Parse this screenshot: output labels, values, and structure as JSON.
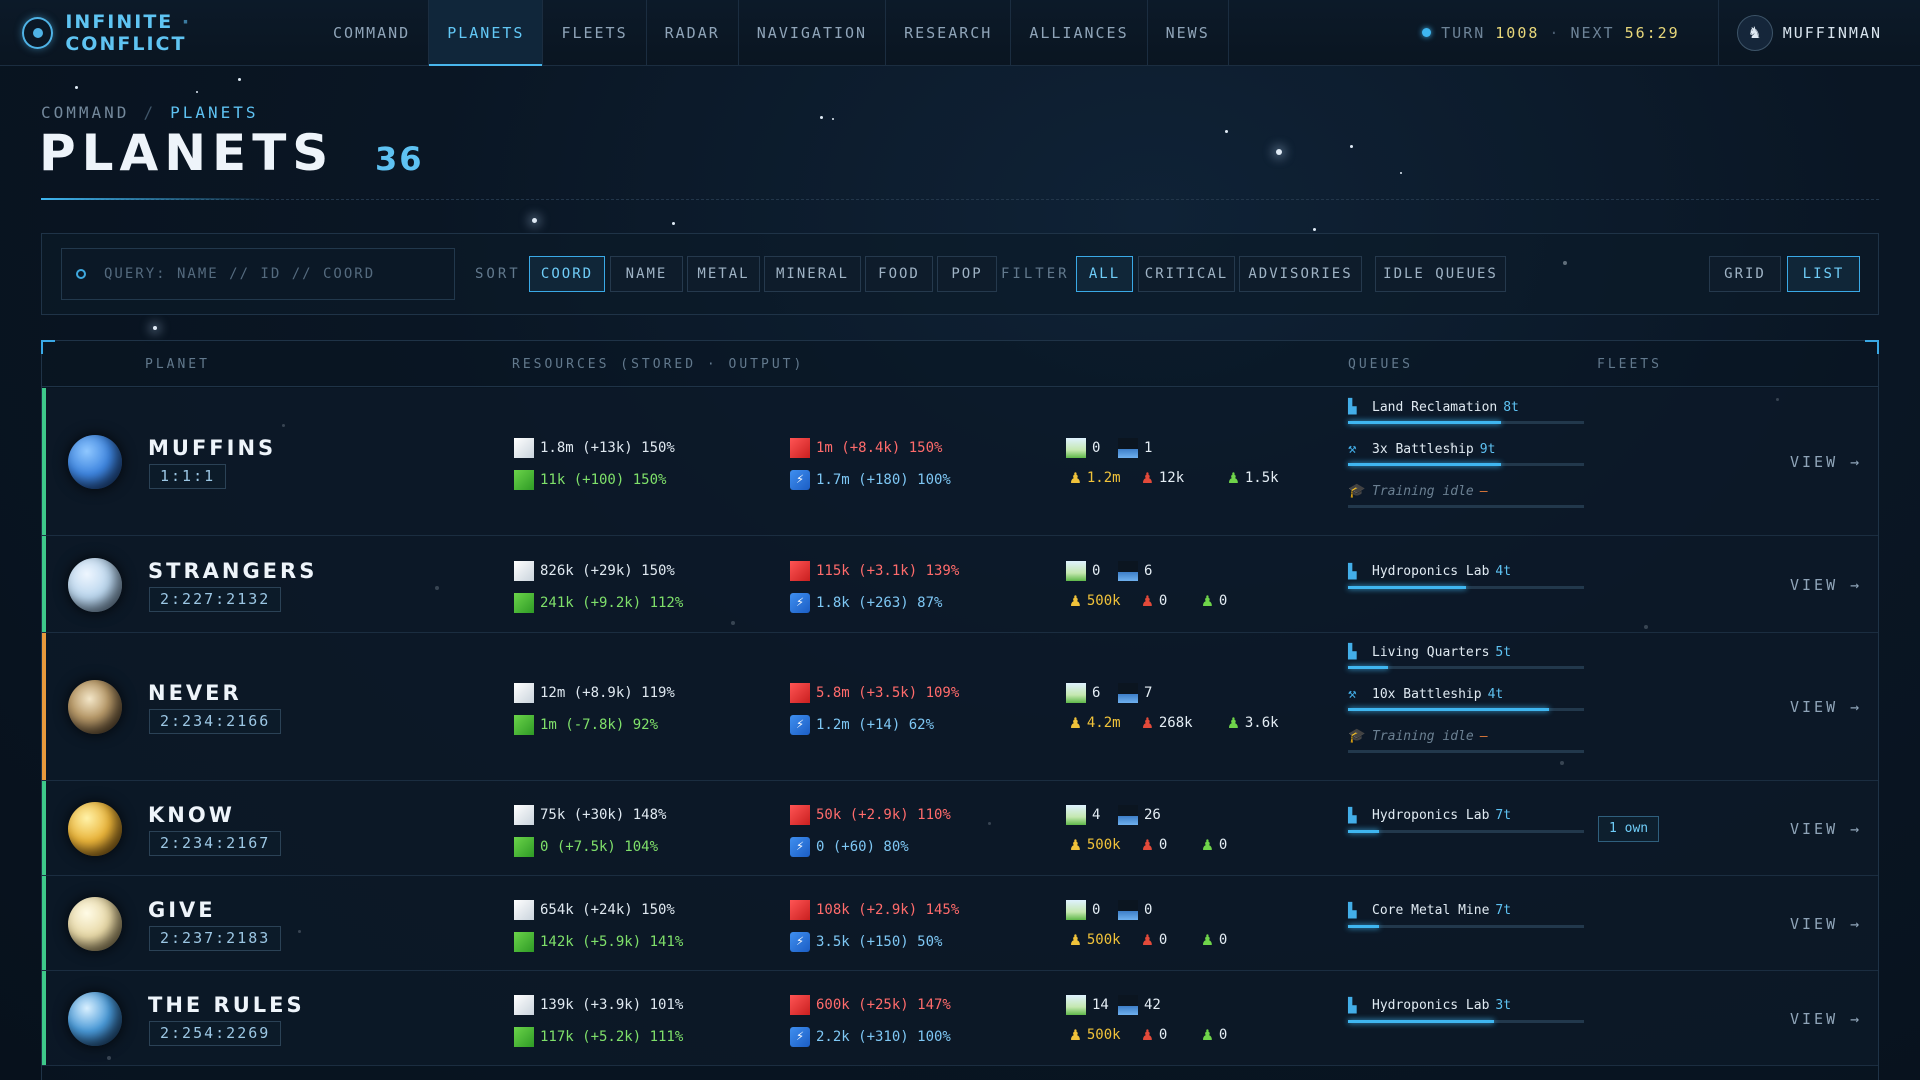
{
  "app": {
    "title_left": "INFINITE",
    "title_sep": "·",
    "title_right": "CONFLICT"
  },
  "nav": [
    "COMMAND",
    "PLANETS",
    "FLEETS",
    "RADAR",
    "NAVIGATION",
    "RESEARCH",
    "ALLIANCES",
    "NEWS"
  ],
  "nav_active": "PLANETS",
  "turn": {
    "label": "TURN",
    "value": "1008",
    "sep": "·",
    "next_label": "NEXT",
    "next_value": "56:29"
  },
  "user": {
    "name": "MUFFINMAN"
  },
  "breadcrumb": {
    "root": "COMMAND",
    "sep": "/",
    "current": "PLANETS"
  },
  "page": {
    "title": "PLANETS",
    "count": "36"
  },
  "search": {
    "placeholder": "QUERY: NAME // ID // COORD"
  },
  "sort": {
    "label": "SORT",
    "options": [
      "COORD",
      "NAME",
      "METAL",
      "MINERAL",
      "FOOD",
      "POP"
    ],
    "active": "COORD"
  },
  "filter": {
    "label": "FILTER",
    "options": [
      "ALL",
      "CRITICAL",
      "ADVISORIES",
      "IDLE QUEUES"
    ],
    "active": "ALL"
  },
  "view_toggle": {
    "options": [
      "GRID",
      "LIST"
    ],
    "active": "LIST"
  },
  "columns": {
    "planet": "PLANET",
    "resources": "RESOURCES (STORED · OUTPUT)",
    "queues": "QUEUES",
    "fleets": "FLEETS"
  },
  "view_label": "VIEW →",
  "colors": {
    "accent": "#3fb6f0",
    "green_status": "#3ec98a",
    "orange_status": "#e89a3c"
  },
  "planets": [
    {
      "name": "MUFFINS",
      "coord": "1:1:1",
      "status_color": "#3ec98a",
      "planet_color": "blue",
      "metal": "1.8m (+13k) 150%",
      "mineral": "1m (+8.4k) 150%",
      "food": "11k (+100) 150%",
      "energy": "1.7m (+180) 100%",
      "land": "0",
      "water": "1",
      "pop": "1.2m",
      "mil": "12k",
      "civ": "1.5k",
      "queues": [
        {
          "icon": "factory-icon",
          "text": "Land Reclamation",
          "turns": "8t",
          "progress": 0.65
        },
        {
          "icon": "hammer-icon",
          "text": "3x Battleship",
          "turns": "9t",
          "progress": 0.65
        },
        {
          "icon": "graduation-cap-icon",
          "text": "Training idle",
          "idle": true,
          "dash": "—"
        }
      ],
      "fleet": ""
    },
    {
      "name": "STRANGERS",
      "coord": "2:227:2132",
      "status_color": "#3ec98a",
      "planet_color": "pale",
      "metal": "826k (+29k) 150%",
      "mineral": "115k (+3.1k) 139%",
      "food": "241k (+9.2k) 112%",
      "energy": "1.8k (+263) 87%",
      "land": "0",
      "water": "6",
      "pop": "500k",
      "mil": "0",
      "civ": "0",
      "queues": [
        {
          "icon": "factory-icon",
          "text": "Hydroponics Lab",
          "turns": "4t",
          "progress": 0.5
        }
      ],
      "fleet": ""
    },
    {
      "name": "NEVER",
      "coord": "2:234:2166",
      "status_color": "#e89a3c",
      "planet_color": "rocky",
      "metal": "12m (+8.9k) 119%",
      "mineral": "5.8m (+3.5k) 109%",
      "food": "1m (-7.8k) 92%",
      "energy": "1.2m (+14) 62%",
      "land": "6",
      "water": "7",
      "pop": "4.2m",
      "mil": "268k",
      "civ": "3.6k",
      "queues": [
        {
          "icon": "factory-icon",
          "text": "Living Quarters",
          "turns": "5t",
          "progress": 0.17
        },
        {
          "icon": "hammer-icon",
          "text": "10x Battleship",
          "turns": "4t",
          "progress": 0.85
        },
        {
          "icon": "graduation-cap-icon",
          "text": "Training idle",
          "idle": true,
          "dash": "—"
        }
      ],
      "fleet": ""
    },
    {
      "name": "KNOW",
      "coord": "2:234:2167",
      "status_color": "#3ec98a",
      "planet_color": "gold",
      "metal": "75k (+30k) 148%",
      "mineral": "50k (+2.9k) 110%",
      "food": "0 (+7.5k) 104%",
      "energy": "0 (+60) 80%",
      "land": "4",
      "water": "26",
      "pop": "500k",
      "mil": "0",
      "civ": "0",
      "queues": [
        {
          "icon": "factory-icon",
          "text": "Hydroponics Lab",
          "turns": "7t",
          "progress": 0.13
        }
      ],
      "fleet": "1 own"
    },
    {
      "name": "GIVE",
      "coord": "2:237:2183",
      "status_color": "#3ec98a",
      "planet_color": "cream",
      "metal": "654k (+24k) 150%",
      "mineral": "108k (+2.9k) 145%",
      "food": "142k (+5.9k) 141%",
      "energy": "3.5k (+150) 50%",
      "land": "0",
      "water": "0",
      "pop": "500k",
      "mil": "0",
      "civ": "0",
      "queues": [
        {
          "icon": "factory-icon",
          "text": "Core Metal Mine",
          "turns": "7t",
          "progress": 0.13
        }
      ],
      "fleet": ""
    },
    {
      "name": "THE RULES",
      "coord": "2:254:2269",
      "status_color": "#3ec98a",
      "planet_color": "ocean",
      "metal": "139k (+3.9k) 101%",
      "mineral": "600k (+25k) 147%",
      "food": "117k (+5.2k) 111%",
      "energy": "2.2k (+310) 100%",
      "land": "14",
      "water": "42",
      "pop": "500k",
      "mil": "0",
      "civ": "0",
      "queues": [
        {
          "icon": "factory-icon",
          "text": "Hydroponics Lab",
          "turns": "3t",
          "progress": 0.62
        }
      ],
      "fleet": ""
    }
  ]
}
